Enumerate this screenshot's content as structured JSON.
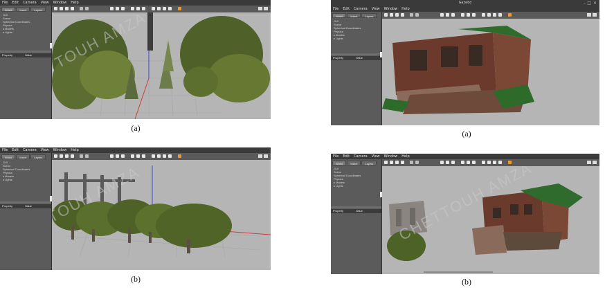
{
  "menu": [
    "File",
    "Edit",
    "Camera",
    "View",
    "Window",
    "Help"
  ],
  "tabs": [
    "World",
    "Insert",
    "Layers"
  ],
  "tree_items": [
    "GUI",
    "Scene",
    "Spherical Coordinates",
    "Physics",
    "Models",
    "Lights"
  ],
  "properties": {
    "property": "Property",
    "value": "Value"
  },
  "app_title": "Gazebo",
  "watermark": "CHETTOUH AMZA",
  "captions": {
    "top_left": "(a)",
    "top_right": "(a)",
    "bottom_left": "(b)",
    "bottom_right": "(b)"
  },
  "colors": {
    "toolbar_accent": "#f09a2b",
    "viewport_bg": "#b5b5b5",
    "panel_bg": "#5b5b5b"
  }
}
